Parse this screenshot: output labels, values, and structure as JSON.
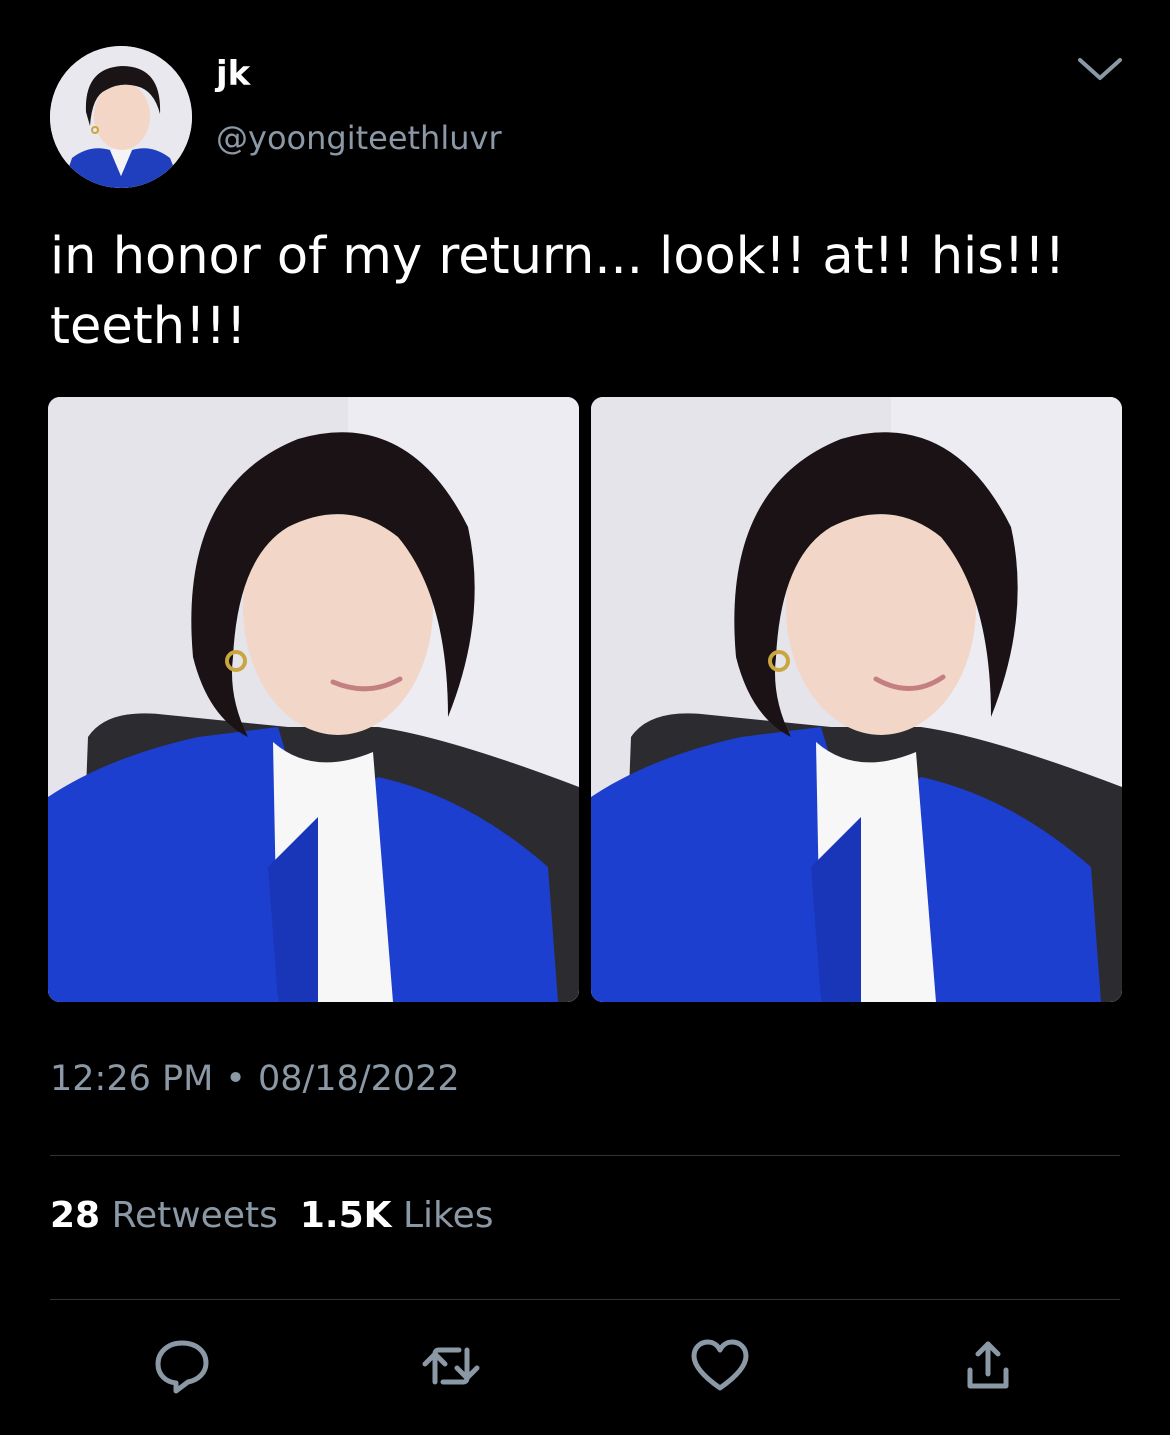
{
  "tweet": {
    "author": {
      "display_name": "jk",
      "handle": "@yoongiteethluvr"
    },
    "text": "in honor of my return... look!! at!! his!!! teeth!!!",
    "media_count": 2,
    "time": "12:26 PM",
    "separator": "•",
    "date": "08/18/2022",
    "stats": {
      "retweets_count": "28",
      "retweets_label": "Retweets",
      "likes_count": "1.5K",
      "likes_label": "Likes"
    }
  },
  "icons": {
    "menu": "chevron-down-icon",
    "reply": "reply-icon",
    "retweet": "retweet-icon",
    "like": "heart-icon",
    "share": "share-icon"
  },
  "colors": {
    "background": "#000000",
    "primary_text": "#ffffff",
    "secondary_text": "#8b98a5",
    "divider": "#2f3336"
  }
}
